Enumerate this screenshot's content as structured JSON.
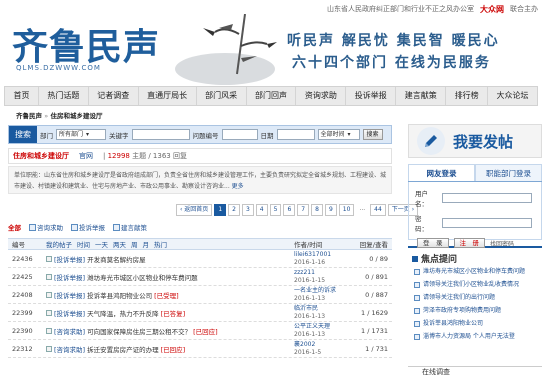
{
  "topbar": {
    "sponsor": "山东省人民政府纠正部门和行业不正之风办公室",
    "logo": "大众网",
    "partner": "联合主办"
  },
  "header": {
    "brand": "齐鲁民声",
    "domain": "QLMS.DZWWW.COM",
    "slogan1": "听民声 解民忧 集民智 暖民心",
    "slogan2": "六十四个部门 在线为民服务"
  },
  "nav": [
    "首页",
    "热门话题",
    "记者调查",
    "直通厅局长",
    "部门风采",
    "部门回声",
    "资询求助",
    "投诉举报",
    "建言献策",
    "排行榜",
    "大众论坛"
  ],
  "breadcrumb": {
    "root": "齐鲁民声",
    "sep": "»",
    "current": "住房和城乡建设厅"
  },
  "search": {
    "button": "搜索",
    "dept_label": "部门",
    "dept_value": "所有部门",
    "keyword_label": "关键字",
    "date_label": "问题编号",
    "date_label2": "日期",
    "time_value": "全部时间",
    "go": "搜索"
  },
  "dept": {
    "name": "住房和城乡建设厅",
    "admin": "官网",
    "topics": "12998",
    "topics_label": "主题",
    "replies": "1363",
    "replies_label": "回复"
  },
  "intro": {
    "text": "单位职能：山东省住房和城乡建设厅是省政府组成部门，负责全省住房和城乡建设管理工作，主要负责研究拟定全省城乡规划、工程建设、城市建设、村镇建设和建筑业、住宅与房地产业、市政公用事业、勘察设计咨询业...",
    "more": "更多"
  },
  "pager": {
    "prev": "‹ 返回首页",
    "pages": [
      "1",
      "2",
      "3",
      "4",
      "5",
      "6",
      "7",
      "8",
      "9",
      "10"
    ],
    "current": "1",
    "dots": "...",
    "last": "44",
    "next": "下一页 ›"
  },
  "tabs": [
    {
      "label": "全部",
      "cur": true
    },
    {
      "label": "咨询求助",
      "cur": false
    },
    {
      "label": "投诉举报",
      "cur": false
    },
    {
      "label": "建言献策",
      "cur": false
    }
  ],
  "table": {
    "head": {
      "id": "编号",
      "filters": [
        "我的帖子",
        "时间",
        "一天",
        "两天",
        "周",
        "月",
        "热门"
      ],
      "author": "作者/时间",
      "replies": "回复/查看"
    },
    "rows": [
      {
        "id": "22436",
        "cat": "[投诉举报]",
        "title": "开发商莫名解约房屋",
        "status": "",
        "user": "lilei6317001",
        "date": "2016-1-16",
        "stats": "0 / 89"
      },
      {
        "id": "22425",
        "cat": "[投诉举报]",
        "title": "潍坊寿光市城区小区物业和停车费问题",
        "status": "",
        "user": "zzz211",
        "date": "2016-1-15",
        "stats": "0 / 891"
      },
      {
        "id": "22408",
        "cat": "[投诉举报]",
        "title": "投诉莘县鸿阳物业公司",
        "status": "[已受理]",
        "user": "一名业主的诉求",
        "date": "2016-1-13",
        "stats": "0 / 887"
      },
      {
        "id": "22399",
        "cat": "[投诉举报]",
        "title": "天气降温，热力不升反降",
        "status": "[已答复]",
        "user": "临沂市民",
        "date": "2016-1-13",
        "stats": "1 / 1629"
      },
      {
        "id": "22390",
        "cat": "[咨询求助]",
        "title": "可向国家保障房住房三期公租不交？",
        "status": "[已回应]",
        "user": "公平正义天理",
        "date": "2016-1-13",
        "stats": "1 / 1731"
      },
      {
        "id": "22312",
        "cat": "[咨询求助]",
        "title": "拆迁安置房房产证的办理",
        "status": "[已回应]",
        "user": "襄2002",
        "date": "2016-1-5",
        "stats": "1 / 731"
      }
    ]
  },
  "right": {
    "post": "我要发帖",
    "tab_login": "网友登录",
    "tab_dept": "职能部门登录",
    "user_label": "用户名：",
    "pass_label": "密　码：",
    "login_btn": "登　录",
    "reg_btn": "注　册",
    "forgot": "找回密码",
    "hot_title": "焦点提问",
    "hot": [
      "潍坊寿光市城区小区物业和停车费问题",
      "请领导关注我们小区物业乱收费情况",
      "请领导关注我们的出行问题",
      "菏泽市政府专项购物费用问题",
      "投诉莘县鸿阳物业公司",
      "淄博市人力资源局 个人用户无法登"
    ],
    "survey": "在线调查"
  },
  "colors": {
    "brand": "#1f5e9c",
    "accent": "#1a5aa0",
    "alert": "#cc0000"
  }
}
